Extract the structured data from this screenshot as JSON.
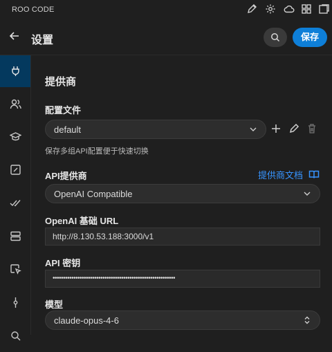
{
  "topbar": {
    "title": "ROO CODE",
    "icons": [
      "edit-icon",
      "gear-icon",
      "cloud-icon",
      "extensions-icon",
      "external-window-icon"
    ]
  },
  "header": {
    "title": "设置",
    "save_label": "保存"
  },
  "sidebar": {
    "items": [
      {
        "icon": "plug-icon",
        "active": true
      },
      {
        "icon": "users-icon"
      },
      {
        "icon": "graduation-cap-icon"
      },
      {
        "icon": "edit-square-icon"
      },
      {
        "icon": "check-all-icon"
      },
      {
        "icon": "server-icon"
      },
      {
        "icon": "pointer-icon"
      },
      {
        "icon": "git-commit-icon"
      },
      {
        "icon": "search-icon"
      }
    ]
  },
  "main": {
    "section_title": "提供商",
    "profile": {
      "label": "配置文件",
      "value": "default",
      "help": "保存多组API配置便于快速切换"
    },
    "provider": {
      "label": "API提供商",
      "docs_link": "提供商文档",
      "value": "OpenAI Compatible"
    },
    "base_url": {
      "label": "OpenAI 基础 URL",
      "value": "http://8.130.53.188:3000/v1"
    },
    "api_key": {
      "label": "API 密钥",
      "value": "•••••••••••••••••••••••••••••••••••••••••••••••••••••••••••"
    },
    "model": {
      "label": "模型",
      "value": "claude-opus-4-6"
    }
  },
  "colors": {
    "accent": "#0e7fd8",
    "link": "#3794ff",
    "active_sidebar": "#04395e"
  }
}
